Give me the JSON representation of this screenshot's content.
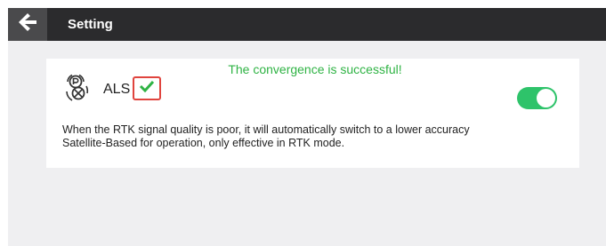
{
  "header": {
    "title": "Setting"
  },
  "card": {
    "status_message": "The convergence is successful!",
    "als_label": "ALS",
    "toggle_state": "on",
    "description_line1": "When the RTK signal quality is poor, it will automatically switch to a lower accuracy",
    "description_line2": "Satellite-Based for operation, only effective in RTK mode."
  },
  "icons": {
    "back": "back-arrow-icon",
    "als": "satellite-positioning-icon",
    "check": "checkmark-icon"
  },
  "colors": {
    "header_bg": "#2b2b2d",
    "back_button_bg": "#4a4a4c",
    "page_bg": "#efeff1",
    "success_green": "#2fb344",
    "toggle_on": "#2ec36a",
    "highlight_red": "#e0443e"
  }
}
